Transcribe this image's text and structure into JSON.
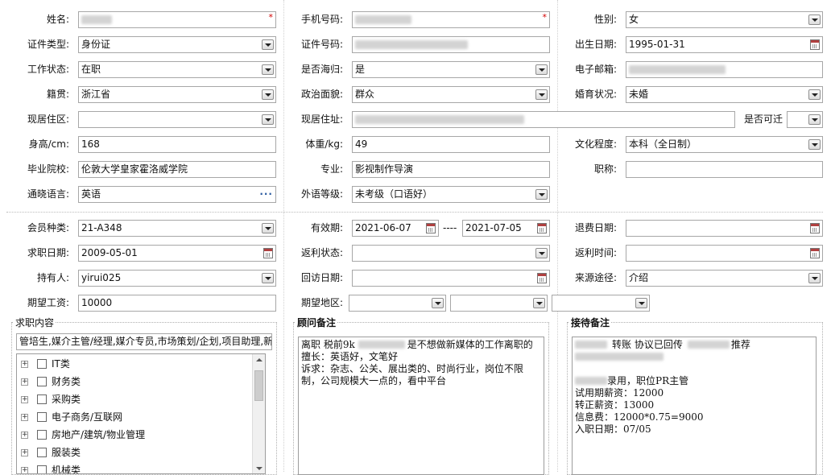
{
  "basic": {
    "name": {
      "label": "姓名:",
      "required": "*"
    },
    "phone": {
      "label": "手机号码:",
      "required": "*"
    },
    "gender": {
      "label": "性别:",
      "value": "女"
    },
    "id_type": {
      "label": "证件类型:",
      "value": "身份证"
    },
    "id_number": {
      "label": "证件号码:"
    },
    "birth_date": {
      "label": "出生日期:",
      "value": "1995-01-31"
    },
    "work_status": {
      "label": "工作状态:",
      "value": "在职"
    },
    "returnee": {
      "label": "是否海归:",
      "value": "是"
    },
    "email": {
      "label": "电子邮箱:"
    },
    "native_place": {
      "label": "籍贯:",
      "value": "浙江省"
    },
    "political": {
      "label": "政治面貌:",
      "value": "群众"
    },
    "marital": {
      "label": "婚育状况:",
      "value": "未婚"
    },
    "residence": {
      "label": "现居住区:",
      "value": ""
    },
    "address": {
      "label": "现居住址:"
    },
    "relocate": {
      "label": "是否可迁",
      "value": ""
    },
    "height": {
      "label": "身高/cm:",
      "value": "168"
    },
    "weight": {
      "label": "体重/kg:",
      "value": "49"
    },
    "education": {
      "label": "文化程度:",
      "value": "本科（全日制）"
    },
    "school": {
      "label": "毕业院校:",
      "value": "伦敦大学皇家霍洛威学院"
    },
    "major": {
      "label": "专业:",
      "value": "影视制作导演"
    },
    "title": {
      "label": "职称:",
      "value": ""
    },
    "languages": {
      "label": "通晓语言:",
      "value": "英语"
    },
    "lang_level": {
      "label": "外语等级:",
      "value": "未考级（口语好）"
    }
  },
  "member": {
    "type": {
      "label": "会员种类:",
      "value": "21-A348"
    },
    "valid": {
      "label": "有效期:",
      "from": "2021-06-07",
      "sep": "----",
      "to": "2021-07-05"
    },
    "refund_date": {
      "label": "退费日期:",
      "value": ""
    },
    "job_date": {
      "label": "求职日期:",
      "value": "2009-05-01"
    },
    "rebate_status": {
      "label": "返利状态:",
      "value": ""
    },
    "rebate_time": {
      "label": "返利时间:",
      "value": ""
    },
    "holder": {
      "label": "持有人:",
      "value": "yirui025"
    },
    "visit_date": {
      "label": "回访日期:",
      "value": ""
    },
    "source": {
      "label": "来源途径:",
      "value": "介绍"
    },
    "salary": {
      "label": "期望工资:",
      "value": "10000"
    },
    "region": {
      "label": "期望地区:",
      "v1": "",
      "v2": "",
      "v3": ""
    }
  },
  "job_intent": {
    "legend": "求职内容",
    "summary": "管培生,媒介主管/经理,媒介专员,市场策划/企划,项目助理,新",
    "categories": [
      "IT类",
      "财务类",
      "采购类",
      "电子商务/互联网",
      "房地产/建筑/物业管理",
      "服装类",
      "机械类"
    ]
  },
  "consultant_notes": {
    "legend": "顾问备注",
    "lines": [
      "离职 税前9k",
      "是不想做新媒体的工作离职的",
      "擅长：英语好，文笔好",
      "诉求：杂志、公关、展出类的、时尚行业，岗位不限",
      "制，公司规模大一点的，看中平台"
    ]
  },
  "reception_notes": {
    "legend": "接待备注",
    "line1a": "转账 协议已回传",
    "line1b": "推荐",
    "line2": "录用，职位PR主管",
    "line3": "试用期薪资：12000",
    "line4": "转正薪资：13000",
    "line5": "信息费：12000*0.75=9000",
    "line6": "入职日期：07/05"
  }
}
